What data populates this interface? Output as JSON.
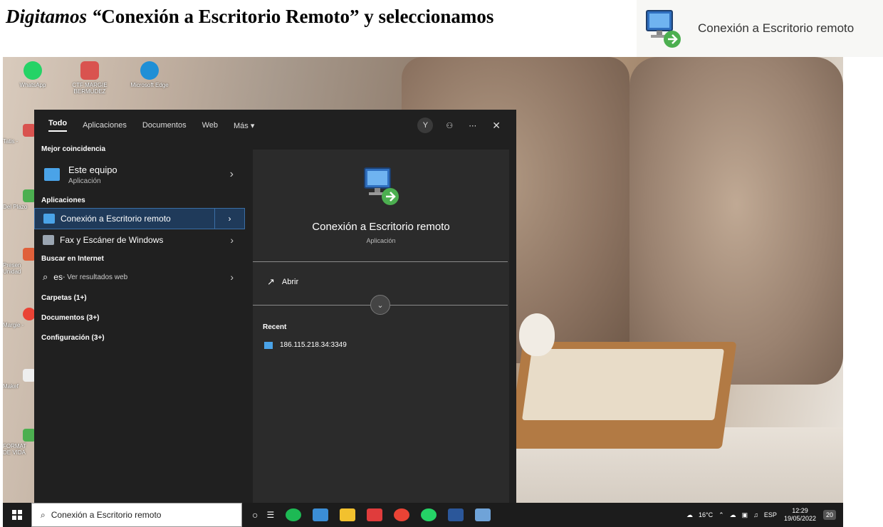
{
  "heading": {
    "italic": "Digitamos “",
    "bold": "Conexión a Escritorio Remoto” y seleccionamos"
  },
  "hint": {
    "label": "Conexión a Escritorio remoto"
  },
  "desktop_icons": [
    {
      "label": "WhatsApp",
      "color": "#25d366"
    },
    {
      "label": "CTF MARGIE BERMUDEZ",
      "color": "#d9534f"
    },
    {
      "label": "Microsoft Edge",
      "color": "#1f8fd6"
    }
  ],
  "side_icons": [
    "Tatis -",
    "Del Plazo",
    "Presen Unidad",
    "Margie -",
    "Makef",
    "FORMAT DE VIDA"
  ],
  "search": {
    "tabs": [
      "Todo",
      "Aplicaciones",
      "Documentos",
      "Web",
      "Más ▾"
    ],
    "avatar": "Y",
    "best_section": "Mejor coincidencia",
    "best": {
      "title": "Este equipo",
      "subtitle": "Aplicación"
    },
    "apps_section": "Aplicaciones",
    "apps": [
      "Conexión a Escritorio remoto",
      "Fax y Escáner de Windows"
    ],
    "web_section": "Buscar en Internet",
    "web_query": "es",
    "web_suffix": " - Ver resultados web",
    "folders": "Carpetas (1+)",
    "documents": "Documentos (3+)",
    "settings": "Configuración (3+)"
  },
  "preview": {
    "title": "Conexión a Escritorio remoto",
    "subtitle": "Aplicación",
    "open": "Abrir",
    "recent_label": "Recent",
    "recent_item": "186.115.218.34:3349"
  },
  "taskbar": {
    "search_value": "Conexión a Escritorio remoto",
    "temperature": "16°C",
    "language": "ESP",
    "time": "12:29",
    "date": "19/05/2022",
    "notifications": "20"
  }
}
